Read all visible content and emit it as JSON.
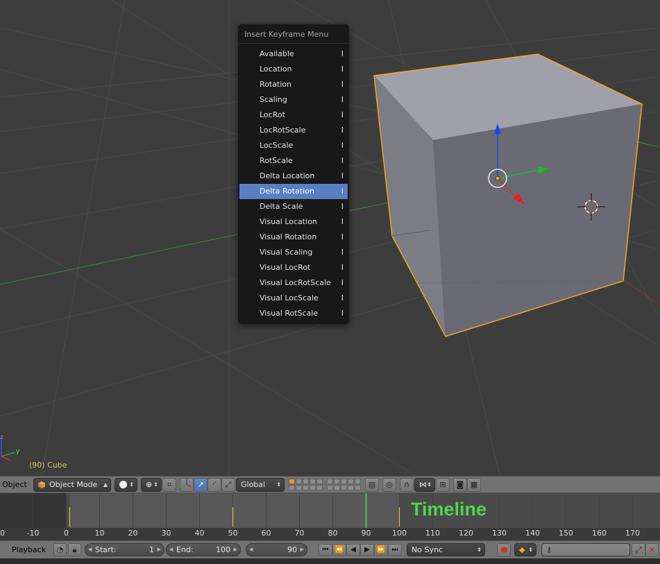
{
  "menu": {
    "title": "Insert Keyframe Menu",
    "items": [
      {
        "label": "Available",
        "shortcut": "I"
      },
      {
        "label": "Location",
        "shortcut": "I"
      },
      {
        "label": "Rotation",
        "shortcut": "I"
      },
      {
        "label": "Scaling",
        "shortcut": "I"
      },
      {
        "label": "LocRot",
        "shortcut": "I"
      },
      {
        "label": "LocRotScale",
        "shortcut": "I"
      },
      {
        "label": "LocScale",
        "shortcut": "I"
      },
      {
        "label": "RotScale",
        "shortcut": "I"
      },
      {
        "label": "Delta Location",
        "shortcut": "I"
      },
      {
        "label": "Delta Rotation",
        "shortcut": "I"
      },
      {
        "label": "Delta Scale",
        "shortcut": "I"
      },
      {
        "label": "Visual Location",
        "shortcut": "I"
      },
      {
        "label": "Visual Rotation",
        "shortcut": "I"
      },
      {
        "label": "Visual Scaling",
        "shortcut": "I"
      },
      {
        "label": "Visual LocRot",
        "shortcut": "I"
      },
      {
        "label": "Visual LocRotScale",
        "shortcut": "I"
      },
      {
        "label": "Visual LocScale",
        "shortcut": "I"
      },
      {
        "label": "Visual RotScale",
        "shortcut": "I"
      }
    ],
    "active_index": 9
  },
  "viewport": {
    "object_label": "(90) Cube",
    "gizmo": {
      "x": "y",
      "z": "z"
    }
  },
  "view_header": {
    "menu_object": "Object",
    "mode": "Object Mode",
    "orientation": "Global"
  },
  "timeline": {
    "title": "Timeline",
    "ticks": [
      "0",
      "-10",
      "0",
      "10",
      "20",
      "30",
      "40",
      "50",
      "60",
      "70",
      "80",
      "90",
      "100",
      "110",
      "120",
      "130",
      "140",
      "150",
      "160",
      "170"
    ],
    "current_frame": 90,
    "keyframes": [
      1,
      50,
      100
    ],
    "range": [
      1,
      100
    ]
  },
  "timeline_header": {
    "playback": "Playback",
    "start_label": "Start:",
    "start_value": "1",
    "end_label": "End:",
    "end_value": "100",
    "current_value": "90",
    "sync": "No Sync"
  },
  "colors": {
    "selection": "#f5a623",
    "menu_highlight": "#5680c2",
    "timeline_title": "#4fd64f",
    "frame_line": "#4fc24f"
  },
  "icons": [
    "cube-icon",
    "sphere-icon",
    "play-icon",
    "rewind-icon",
    "record-icon",
    "key-icon",
    "camera-icon",
    "clapper-icon"
  ]
}
